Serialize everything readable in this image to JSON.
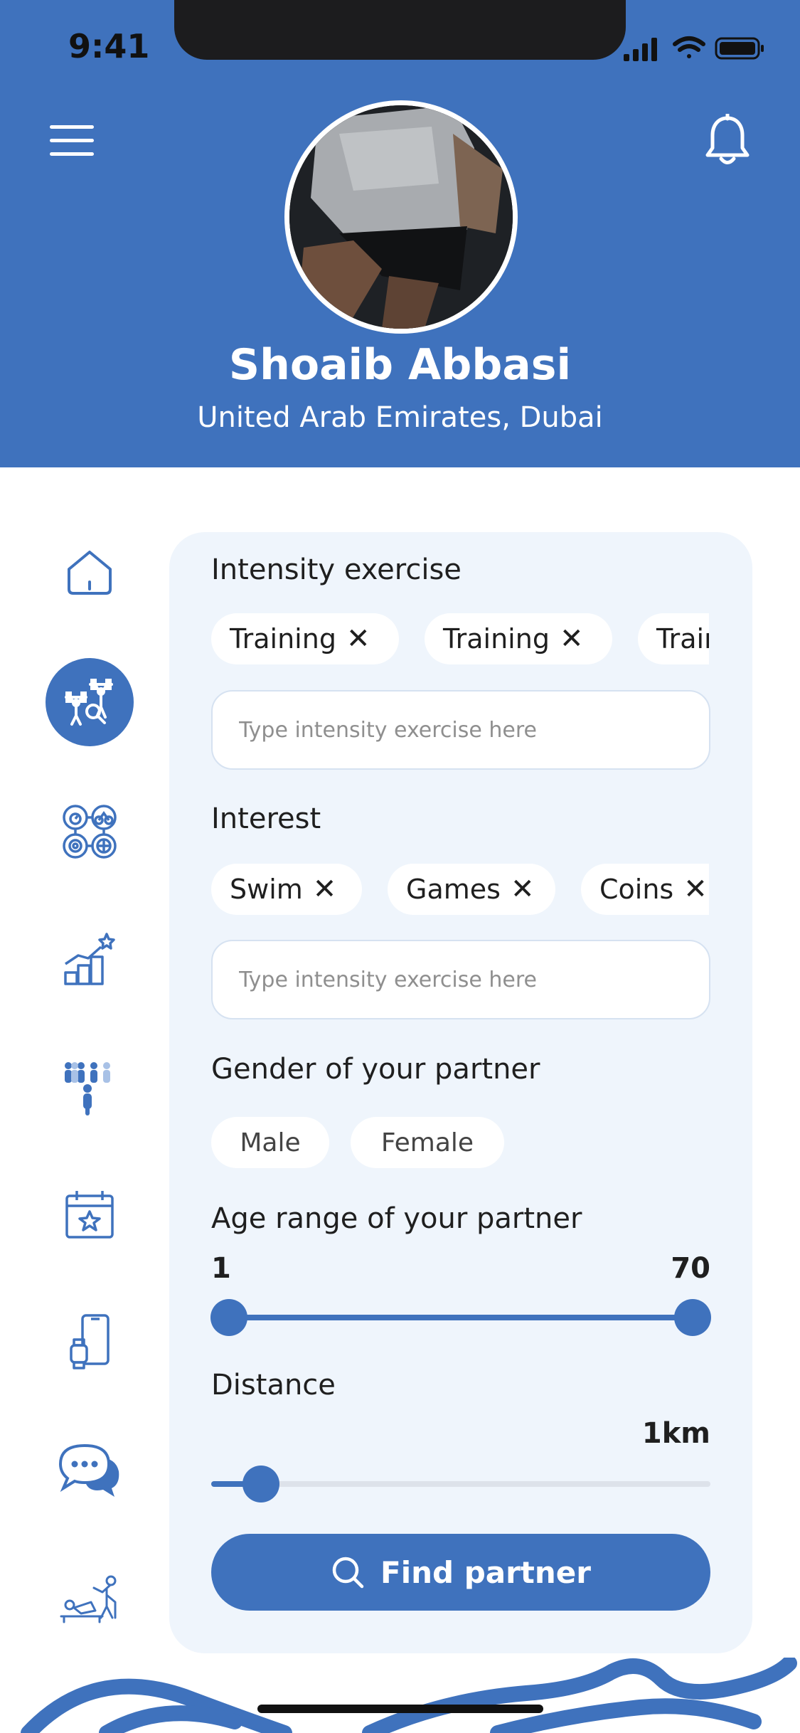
{
  "status_bar": {
    "time": "9:41"
  },
  "profile": {
    "name": "Shoaib Abbasi",
    "location": "United Arab Emirates, Dubai"
  },
  "icons": {
    "menu": "hamburger-menu-icon",
    "notifications": "bell-icon",
    "rail": [
      "home-icon",
      "weightlifting-icon",
      "sports-activities-icon",
      "progress-chart-icon",
      "community-group-icon",
      "calendar-star-icon",
      "phone-watch-icon",
      "chat-bubbles-icon",
      "physiotherapy-icon"
    ],
    "search": "search-icon"
  },
  "form": {
    "intensity_title": "Intensity exercise",
    "intensity_tags": [
      "Training",
      "Training",
      "Training"
    ],
    "intensity_placeholder": "Type intensity exercise here",
    "interest_title": "Interest",
    "interest_tags": [
      "Swim",
      "Games",
      "Coins"
    ],
    "interest_placeholder": "Type intensity exercise here",
    "gender_title": "Gender of your partner",
    "gender_options": [
      "Male",
      "Female"
    ],
    "age_title": "Age range of your partner",
    "age_min": "1",
    "age_max": "70",
    "distance_title": "Distance",
    "distance_value": "1km",
    "distance_level": 0.1,
    "find_button": "Find partner"
  },
  "colors": {
    "primary": "#3f72bd",
    "card_background": "#eff5fc",
    "track_inactive": "#dde2ea"
  }
}
